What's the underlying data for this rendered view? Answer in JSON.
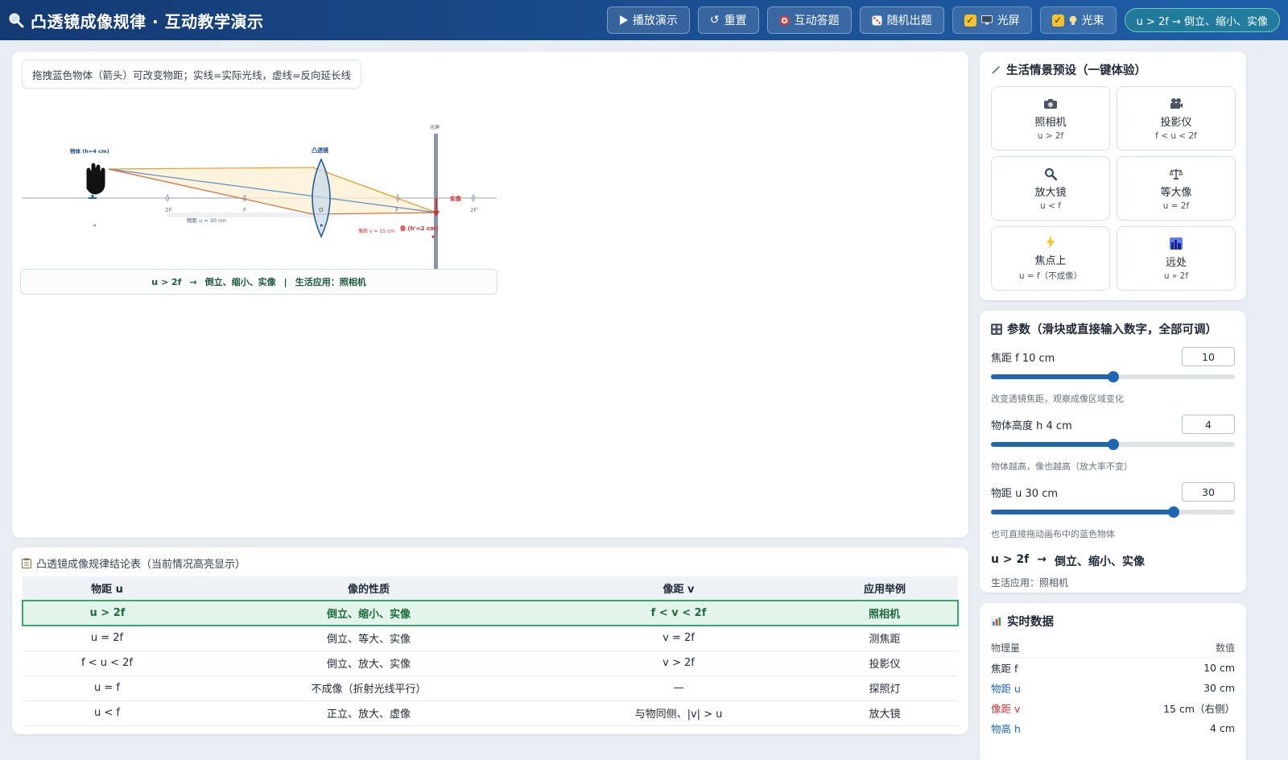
{
  "header": {
    "title": "凸透镜成像规律 · 互动教学演示",
    "buttons": {
      "play": "播放演示",
      "reset": "重置",
      "quiz": "互动答题",
      "random": "随机出题"
    },
    "toggles": {
      "screen": "光屏",
      "beam": "光束"
    },
    "status": "u > 2f → 倒立、缩小、实像"
  },
  "canvas": {
    "hint": "拖拽蓝色物体（箭头）可改变物距；实线=实际光线，虚线=反向延长线",
    "labels": {
      "object": "物体 (h=4 cm)",
      "lens": "凸透镜",
      "screen": "光屏",
      "image": "实像",
      "f_left": "F",
      "twof_left": "2F",
      "f_right": "F",
      "twof_right": "2F'",
      "center": "O",
      "u_label": "物距 u = 30 cm",
      "v_label": "像距 v = 15 cm",
      "image_h": "像 (h'=2 cm)"
    },
    "banner": {
      "rule": "u > 2f",
      "arrow": "→",
      "result": "倒立、缩小、实像",
      "sep": "|",
      "app": "生活应用：照相机"
    }
  },
  "table": {
    "title": "凸透镜成像规律结论表（当前情况高亮显示）",
    "headers": [
      "物距 u",
      "像的性质",
      "像距 v",
      "应用举例"
    ],
    "rows": [
      [
        "u > 2f",
        "倒立、缩小、实像",
        "f < v < 2f",
        "照相机"
      ],
      [
        "u = 2f",
        "倒立、等大、实像",
        "v = 2f",
        "测焦距"
      ],
      [
        "f < u < 2f",
        "倒立、放大、实像",
        "v > 2f",
        "投影仪"
      ],
      [
        "u = f",
        "不成像（折射光线平行）",
        "—",
        "探照灯"
      ],
      [
        "u < f",
        "正立、放大、虚像",
        "与物同侧、|v| > u",
        "放大镜"
      ]
    ],
    "highlight_row": 0
  },
  "presets": {
    "title": "生活情景预设（一键体验）",
    "items": [
      {
        "name": "照相机",
        "cond": "u > 2f"
      },
      {
        "name": "投影仪",
        "cond": "f < u < 2f"
      },
      {
        "name": "放大镜",
        "cond": "u < f"
      },
      {
        "name": "等大像",
        "cond": "u = 2f"
      },
      {
        "name": "焦点上",
        "cond": "u = f（不成像）"
      },
      {
        "name": "远处",
        "cond": "u » 2f"
      }
    ]
  },
  "params": {
    "title": "参数（滑块或直接输入数字，全部可调）",
    "focal": {
      "label": "焦距 f",
      "value_text": "10 cm",
      "input": "10",
      "fraction": 0.5,
      "note": "改变透镜焦距，观察成像区域变化"
    },
    "height": {
      "label": "物体高度 h",
      "value_text": "4 cm",
      "input": "4",
      "fraction": 0.5,
      "note": "物体越高，像也越高（放大率不变）"
    },
    "distance": {
      "label": "物距 u",
      "value_text": "30 cm",
      "input": "30",
      "fraction": 0.75,
      "note": "也可直接拖动画布中的蓝色物体"
    },
    "result": {
      "rule": "u > 2f",
      "arrow": "→",
      "text": "倒立、缩小、实像"
    },
    "app": "生活应用：照相机"
  },
  "data": {
    "title": "实时数据",
    "headers": [
      "物理量",
      "数值"
    ],
    "rows": [
      {
        "name": "焦距 f",
        "value": "10 cm",
        "color": "#1f2937"
      },
      {
        "name": "物距 u",
        "value": "30 cm",
        "color": "#1e66b3"
      },
      {
        "name": "像距 v",
        "value": "15 cm（右侧）",
        "color": "#d32f2f"
      },
      {
        "name": "物高 h",
        "value": "4 cm",
        "color": "#1e66b3"
      }
    ]
  },
  "colors": {
    "accent": "#1e66b3",
    "image": "#d32f2f",
    "highlight": "#3aa56a",
    "header": "#1a4f92"
  }
}
